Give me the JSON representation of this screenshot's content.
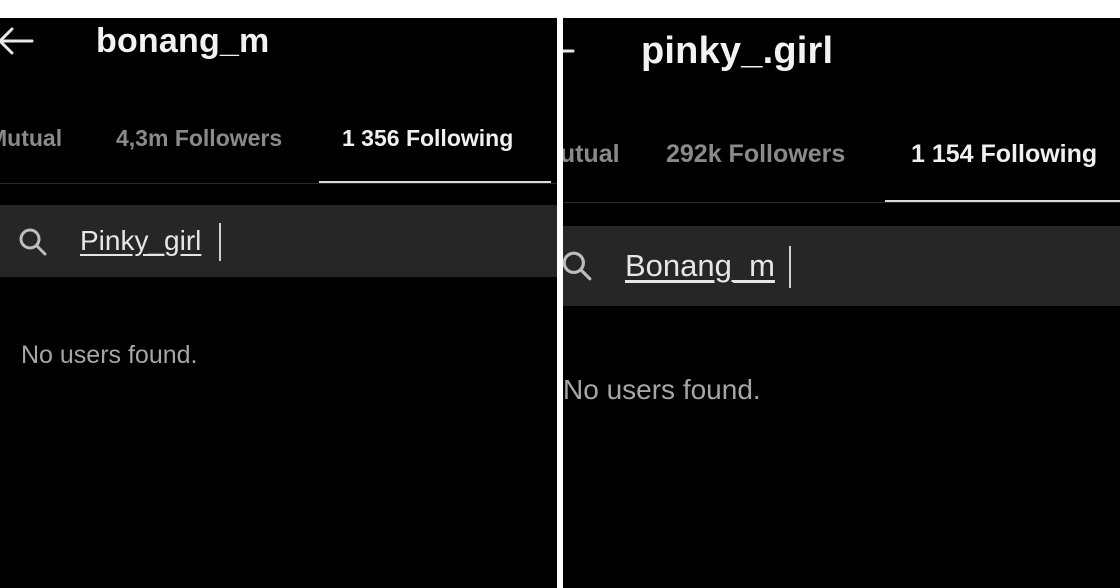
{
  "panels": [
    {
      "title": "bonang_m",
      "tabs": [
        "Mutual",
        "4,3m Followers",
        "1 356 Following"
      ],
      "active_tab": "1 356 Following",
      "search_value": "Pinky_girl",
      "empty_message": "No users found."
    },
    {
      "title": "pinky_.girl",
      "tabs": [
        "Mutual",
        "292k Followers",
        "1 154 Following"
      ],
      "active_tab": "1 154 Following",
      "search_value": "Bonang_m",
      "empty_message": "No users found."
    }
  ],
  "icons": {
    "back": "back-arrow-icon",
    "search": "search-icon"
  },
  "colors": {
    "background": "#000000",
    "search_bg": "#262626",
    "active_tab": "#f0f0f0",
    "inactive_tab": "#8a8a8a"
  }
}
